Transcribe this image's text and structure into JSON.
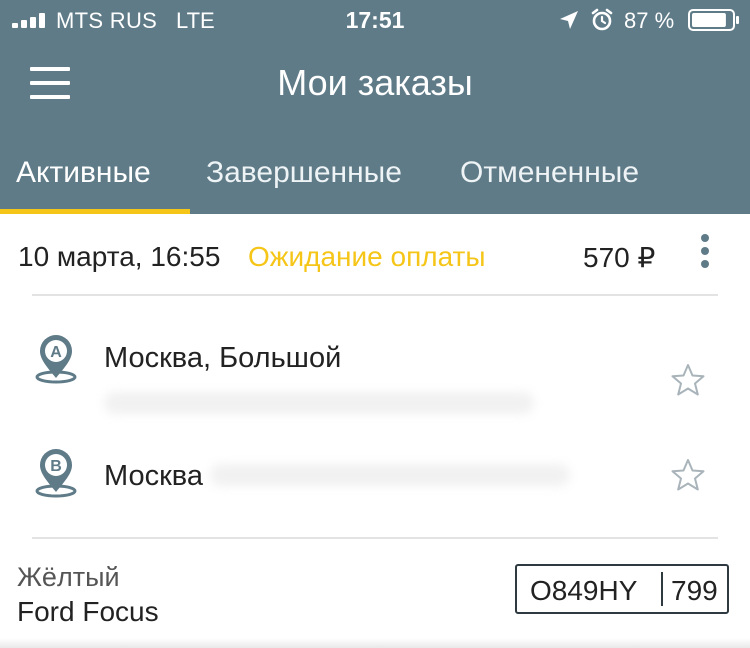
{
  "status_bar": {
    "carrier": "MTS RUS",
    "network": "LTE",
    "time": "17:51",
    "battery_percent": "87 %",
    "battery_level": 0.87,
    "icons": [
      "signal-icon",
      "location-arrow-icon",
      "alarm-clock-icon",
      "battery-icon"
    ]
  },
  "header": {
    "title": "Мои заказы",
    "menu_icon": "hamburger-menu-icon"
  },
  "tabs": [
    {
      "label": "Активные",
      "active": true
    },
    {
      "label": "Завершенные",
      "active": false
    },
    {
      "label": "Отмененные",
      "active": false
    }
  ],
  "order": {
    "date": "10 марта, 16:55",
    "status": "Ожидание оплаты",
    "price": "570 ₽",
    "more_icon": "more-vertical-icon",
    "route": [
      {
        "marker": "A",
        "address": "Москва, Большой"
      },
      {
        "marker": "B",
        "address": "Москва"
      }
    ],
    "car": {
      "color": "Жёлтый",
      "model": "Ford Focus",
      "plate_number": "O849HY",
      "plate_region": "799"
    }
  },
  "colors": {
    "header_bg": "#5f7b88",
    "accent_yellow": "#f5c518",
    "text_dark": "#222222",
    "icon_gray": "#5f7b88"
  }
}
